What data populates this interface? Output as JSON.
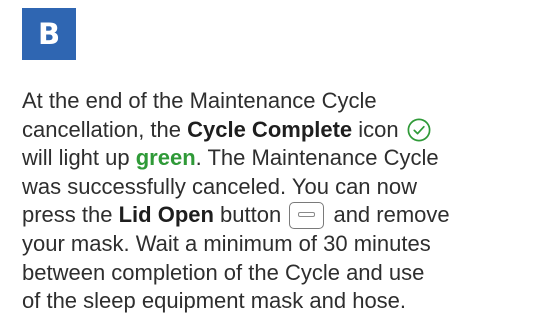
{
  "step_label": "B",
  "instructions": {
    "line1": "At the end of the Maintenance Cycle",
    "line2_pre": "cancellation, the ",
    "line2_bold": "Cycle Complete",
    "line2_post": " icon",
    "line3_pre": "will light up ",
    "line3_green": "green",
    "line3_post": ". The Maintenance Cycle",
    "line4": "was successfully canceled. You can now",
    "line5_pre": "press the ",
    "line5_bold": "Lid Open",
    "line5_mid": " button",
    "line5_post": " and remove",
    "line6": "your mask. Wait a minimum of 30 minutes",
    "line7": "between completion of the Cycle and use",
    "line8": "of the sleep equipment mask and hose."
  },
  "icons": {
    "cycle_complete": "check-circle-icon",
    "lid_open": "lid-open-button-icon"
  },
  "colors": {
    "badge": "#2f66b2",
    "green_text": "#2f9a38",
    "text": "#2e2e2e"
  }
}
